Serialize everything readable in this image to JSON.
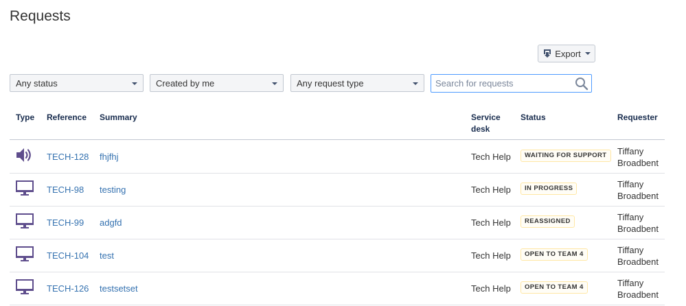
{
  "page": {
    "title": "Requests"
  },
  "toolbar": {
    "export_label": "Export"
  },
  "filters": {
    "status": "Any status",
    "created_by": "Created by me",
    "request_type": "Any request type"
  },
  "search": {
    "placeholder": "Search for requests",
    "value": ""
  },
  "table": {
    "headers": {
      "type": "Type",
      "reference": "Reference",
      "summary": "Summary",
      "service_desk_1": "Service",
      "service_desk_2": "desk",
      "status": "Status",
      "requester": "Requester"
    },
    "rows": [
      {
        "type_icon": "megaphone-icon",
        "reference": "TECH-128",
        "summary": "fhjfhj",
        "service_desk": "Tech Help",
        "status": "WAITING FOR SUPPORT",
        "requester_first": "Tiffany",
        "requester_last": "Broadbent"
      },
      {
        "type_icon": "monitor-icon",
        "reference": "TECH-98",
        "summary": "testing",
        "service_desk": "Tech Help",
        "status": "IN PROGRESS",
        "requester_first": "Tiffany",
        "requester_last": "Broadbent"
      },
      {
        "type_icon": "monitor-icon",
        "reference": "TECH-99",
        "summary": "adgfd",
        "service_desk": "Tech Help",
        "status": "REASSIGNED",
        "requester_first": "Tiffany",
        "requester_last": "Broadbent"
      },
      {
        "type_icon": "monitor-icon",
        "reference": "TECH-104",
        "summary": "test",
        "service_desk": "Tech Help",
        "status": "OPEN TO TEAM 4",
        "requester_first": "Tiffany",
        "requester_last": "Broadbent"
      },
      {
        "type_icon": "monitor-icon",
        "reference": "TECH-126",
        "summary": "testsetset",
        "service_desk": "Tech Help",
        "status": "OPEN TO TEAM 4",
        "requester_first": "Tiffany",
        "requester_last": "Broadbent"
      }
    ]
  },
  "colors": {
    "link": "#3572b0",
    "icon_purple": "#5e4d8c",
    "badge_background": "#fffdf6",
    "badge_border": "#ffe7a4",
    "search_focus": "#4c9aff"
  }
}
